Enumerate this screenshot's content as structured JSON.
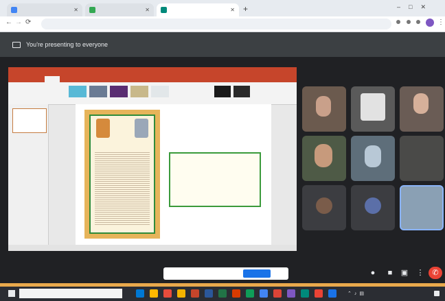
{
  "browser": {
    "tabs": [
      {
        "title": "",
        "active": false,
        "color": "#4285f4"
      },
      {
        "title": "",
        "active": false,
        "color": "#34a853"
      },
      {
        "title": "",
        "active": true,
        "color": "#00897b"
      }
    ],
    "new_tab": "+",
    "address": "",
    "window_controls": [
      "–",
      "□",
      "✕"
    ]
  },
  "meet": {
    "presenting_banner": "You're presenting to everyone",
    "stop_presenting": "",
    "meeting_time": "",
    "meeting_code": "",
    "notification_text": "",
    "notification_action": "",
    "notification_dismiss": "",
    "participants": [
      {
        "name": "",
        "bg": "#6b5a4e"
      },
      {
        "name": "",
        "bg": "#5a5a5a"
      },
      {
        "name": "",
        "bg": "#6a5c55"
      },
      {
        "name": "",
        "bg": "#4e5a46"
      },
      {
        "name": "",
        "bg": "#5e6e7a"
      },
      {
        "name": "",
        "bg": "#4a4a48"
      },
      {
        "name": "",
        "bg": "#3c3d41"
      },
      {
        "name": "",
        "bg": "#3c3d41"
      },
      {
        "name": "",
        "bg": "#8aa0b4"
      }
    ],
    "controls": [
      "mic-icon",
      "camera-icon",
      "present-icon",
      "more-icon",
      "end-call-icon"
    ]
  },
  "slide": {
    "certificate_heading": "",
    "announcement_lines": [
      "",
      "",
      "",
      "",
      "",
      ""
    ]
  },
  "taskbar": {
    "search_placeholder": "",
    "clock": ""
  },
  "colors": {
    "desktop": "#e9a94c",
    "meet_bg": "#202124",
    "ppt_red": "#c6452b",
    "accent_blue": "#1a73e8",
    "end_call": "#ea4335"
  }
}
